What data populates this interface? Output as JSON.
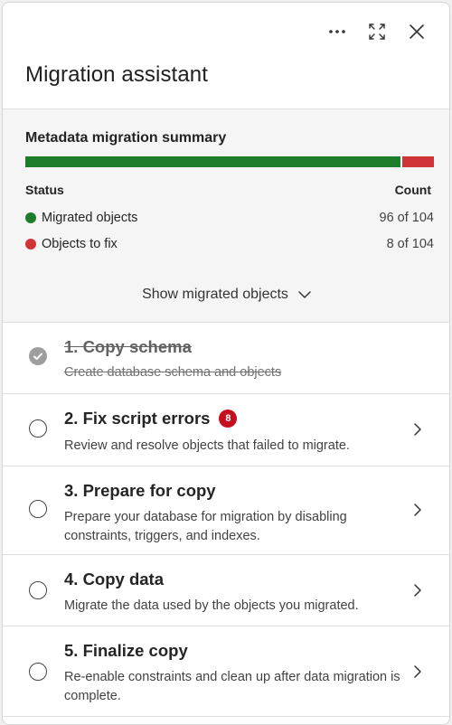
{
  "header": {
    "title": "Migration assistant",
    "more_icon": "more-horizontal-icon",
    "expand_icon": "expand-icon",
    "close_icon": "close-icon"
  },
  "summary": {
    "title": "Metadata migration summary",
    "progress": {
      "migrated_fraction": 0.923,
      "fixed_fraction": 0.077
    },
    "status_label": "Status",
    "count_label": "Count",
    "rows": [
      {
        "label": "Migrated objects",
        "count": "96 of 104",
        "color": "#1e7d2a"
      },
      {
        "label": "Objects to fix",
        "count": "8 of 104",
        "color": "#d13438"
      }
    ],
    "show_button": "Show migrated objects"
  },
  "steps": [
    {
      "title": "1. Copy schema",
      "desc": "Create database schema and objects",
      "completed": true
    },
    {
      "title": "2. Fix script errors",
      "badge": "8",
      "desc": "Review and resolve objects that failed to migrate."
    },
    {
      "title": "3. Prepare for copy",
      "desc": "Prepare your database for migration by disabling constraints, triggers, and indexes."
    },
    {
      "title": "4. Copy data",
      "desc": "Migrate the data used by the objects you migrated."
    },
    {
      "title": "5. Finalize copy",
      "desc": "Re-enable constraints and clean up after data migration is complete."
    }
  ],
  "colors": {
    "accent_green": "#1e7d2a",
    "accent_red": "#d13438",
    "badge_red": "#c50f1f"
  }
}
